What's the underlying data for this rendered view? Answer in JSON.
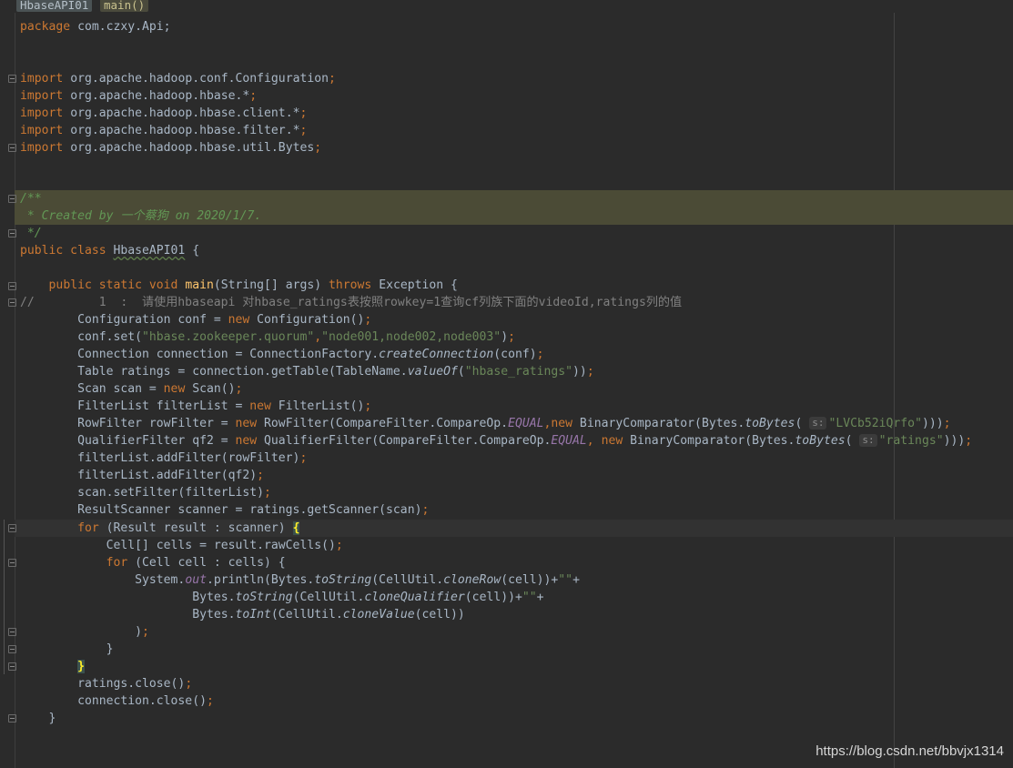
{
  "breadcrumbs": [
    "HbaseAPI01",
    "main()"
  ],
  "code": {
    "package_kw": "package",
    "package_name": " com.czxy.Api;",
    "imports": [
      " org.apache.hadoop.conf.Configuration",
      " org.apache.hadoop.hbase.*",
      " org.apache.hadoop.hbase.client.*",
      " org.apache.hadoop.hbase.filter.*",
      " org.apache.hadoop.hbase.util.Bytes"
    ],
    "import_kw": "import",
    "doc_open": "/**",
    "doc_body": " * Created by 一个蔡狗 on 2020/1/7.",
    "doc_close": " */",
    "class_decl_kw": "public class ",
    "class_name": "HbaseAPI01",
    "class_open": " {",
    "main_mods": "public static void ",
    "main_name": "main",
    "main_params": "(String[] args) ",
    "throws_kw": "throws",
    "main_tail": " Exception {",
    "comment_line": "//         1  :  请使用hbaseapi 对hbase_ratings表按照rowkey=1查询cf列族下面的videoId,ratings列的值",
    "quorum_key": "\"hbase.zookeeper.quorum\"",
    "quorum_val": "\"node001,node002,node003\"",
    "table_name": "\"hbase_ratings\"",
    "row_key": "\"LVCb52iQrfo\"",
    "qualifier": "\"ratings\"",
    "param_hint": "s:",
    "empty_str": "\"\""
  },
  "watermark": "https://blog.csdn.net/bbvjx1314"
}
